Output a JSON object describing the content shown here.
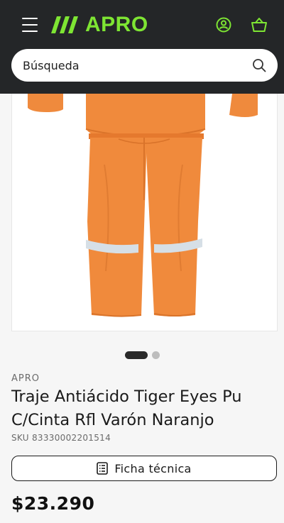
{
  "header": {
    "brand": "APRO",
    "colors": {
      "background": "#242628",
      "accent": "#7ee533"
    },
    "icons": [
      "menu-icon",
      "logo-slashes-icon",
      "account-icon",
      "cart-icon"
    ]
  },
  "search": {
    "placeholder": "Búsqueda",
    "icon": "search-icon"
  },
  "carousel": {
    "slides": 2,
    "active_index": 0
  },
  "product": {
    "vendor": "APRO",
    "title": "Traje Antiácido Tiger Eyes Pu C/Cinta Rfl Varón Naranjo",
    "sku": "SKU 83330002201514",
    "spec_button": "Ficha técnica",
    "spec_icon": "document-list-icon",
    "price": "$23.290",
    "image_colors": {
      "suit": "#f08a3c",
      "reflective_tape": "#d6dfe6"
    }
  }
}
